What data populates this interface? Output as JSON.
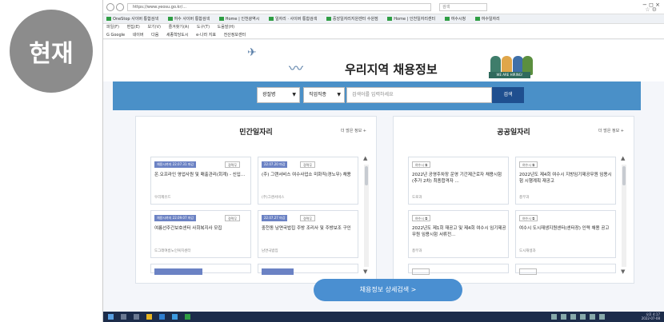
{
  "badge": {
    "label": "현재"
  },
  "browser": {
    "address": "https://www.yeosu.go.kr/...",
    "search_hint": "검색",
    "controls": "− ◻ ×",
    "tabs": [
      {
        "label": "OneStop 사이버 통합검색"
      },
      {
        "label": "여수 사이버 통합검색"
      },
      {
        "label": "Home | 인천광역시"
      },
      {
        "label": "일자리 · 사이버 통합검색"
      },
      {
        "label": "중앙일자리지원센터 수원점"
      },
      {
        "label": "Home | 인천일자리센터"
      },
      {
        "label": "여수시청"
      },
      {
        "label": "여수일자리"
      }
    ],
    "menu": [
      "파일(F)",
      "편집(E)",
      "보기(V)",
      "즐겨찾기(A)",
      "도구(T)",
      "도움말(H)"
    ],
    "favorites": [
      "G Google",
      "네이버",
      "다음",
      "세종학당도시",
      "e-나라 지표",
      "전산정보센터"
    ]
  },
  "hero": {
    "title": "우리지역 채용정보",
    "people_caption": "WE ARE HIRING!"
  },
  "search": {
    "region_value": "광절병",
    "job_value": "직업직종",
    "keyword_placeholder": "검색어를 입력하세요",
    "button_label": "검색"
  },
  "private_jobs": {
    "title": "민간일자리",
    "more_label": "더 많은 정보 +",
    "cards": [
      {
        "badge": "채용시까지 22.07.31 마감",
        "tag": "경력무",
        "title": "온.오프라인 영업사원 및 매출관리(회계) - 신입...",
        "company": "우리제유드"
      },
      {
        "badge": "22.07.20 마감",
        "tag": "경력무",
        "title": "(주) 그랜서비스 여수사업소 미화직(경노무) 채용",
        "company": "(주)그랜서비스"
      },
      {
        "badge": "채용시까지 22.09.07 마감",
        "tag": "경력무",
        "title": "여름선주간보호센터 사회복지사 모집",
        "company": "도그래여름노인복지센터"
      },
      {
        "badge": "22.07.27 마감",
        "tag": "경력무",
        "title": "중천동 남면국밥집 주방 조리사 및 주방보조 구인",
        "company": "남면국밥집"
      }
    ]
  },
  "public_jobs": {
    "title": "공공일자리",
    "more_label": "더 많은 정보 +",
    "cards": [
      {
        "org": "여수시",
        "title": "2022년 공영주차장 운영 기간제근로자 채용시험(추가 2차) 최종합격자 ...",
        "dept": "도로과"
      },
      {
        "org": "여수시",
        "title": "2022년도 제4회 여수시 지방임기제공무원 임용시험 시행계획 재공고",
        "dept": "총무과"
      },
      {
        "org": "여수시",
        "title": "2022년도 제1회 재공고 및 제4회 여수시 임기제공무원 임용시험 서류전...",
        "dept": "총무과"
      },
      {
        "org": "여수시",
        "title": "여수시 도시재생지원센터(센터장) 인력 채용 공고",
        "dept": "도시재생과"
      }
    ]
  },
  "detail_button": {
    "label": "채용정보 상세검색  >"
  },
  "taskbar": {
    "time": "오후 4:17",
    "date": "2022-07-08"
  }
}
